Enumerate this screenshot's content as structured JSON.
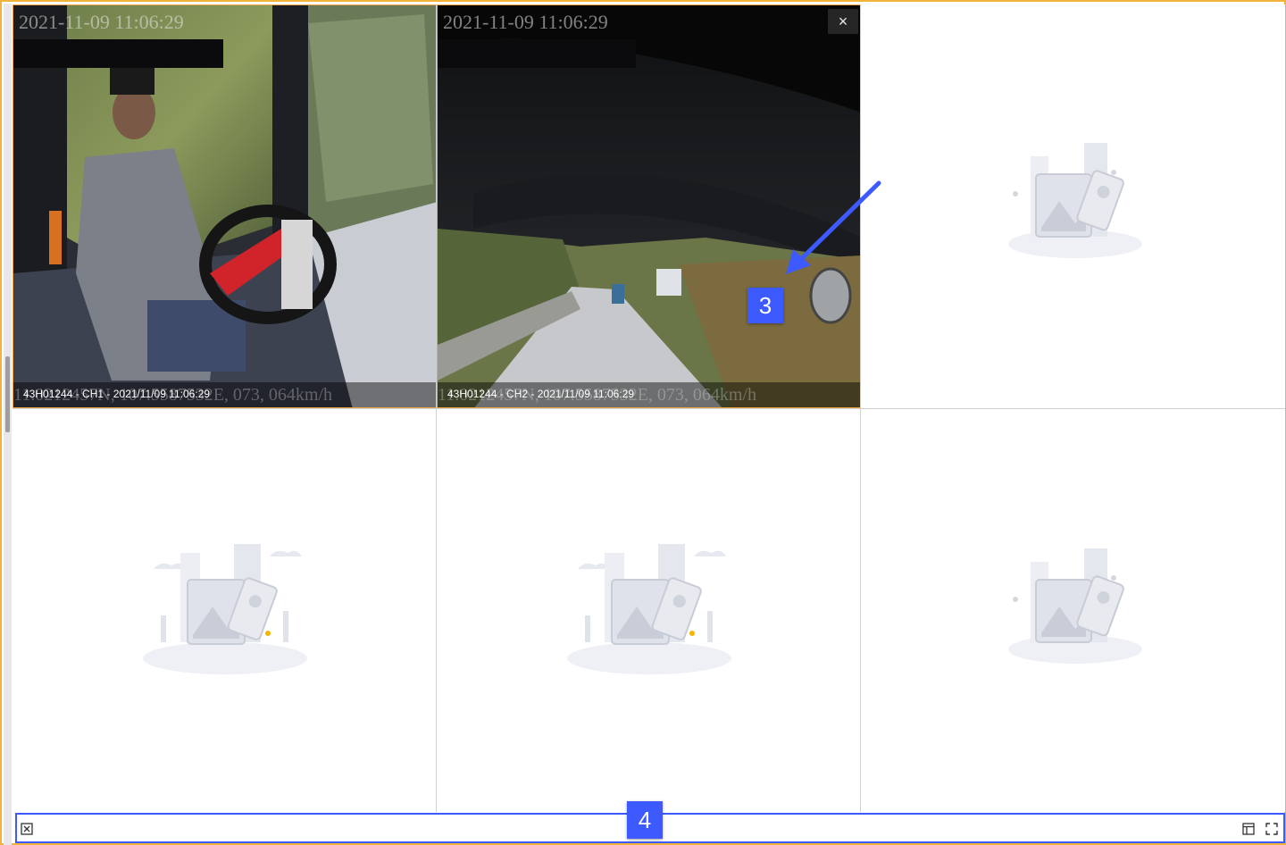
{
  "video_panels": [
    {
      "overlay_timestamp": "2021-11-09 11:06:29",
      "caption": "43H01244 - CH1 - 2021/11/09 11:06:29",
      "gps_overlay": "11.0212457N, 107.5587532E, 073, 064km/h"
    },
    {
      "overlay_timestamp": "2021-11-09 11:06:29",
      "caption": "43H01244 - CH2 - 2021/11/09 11:06:29",
      "gps_overlay": "11.0212457N, 107.5587532E, 073, 064km/h",
      "close_label": "×"
    }
  ],
  "annotations": {
    "three": "3",
    "four": "4"
  },
  "colors": {
    "frame_border": "#f2b33a",
    "active_border": "#f0a640",
    "annotation": "#3d5afe"
  },
  "toolbar": {
    "icons": [
      "close-all-icon",
      "layout-icon",
      "fullscreen-icon"
    ]
  }
}
